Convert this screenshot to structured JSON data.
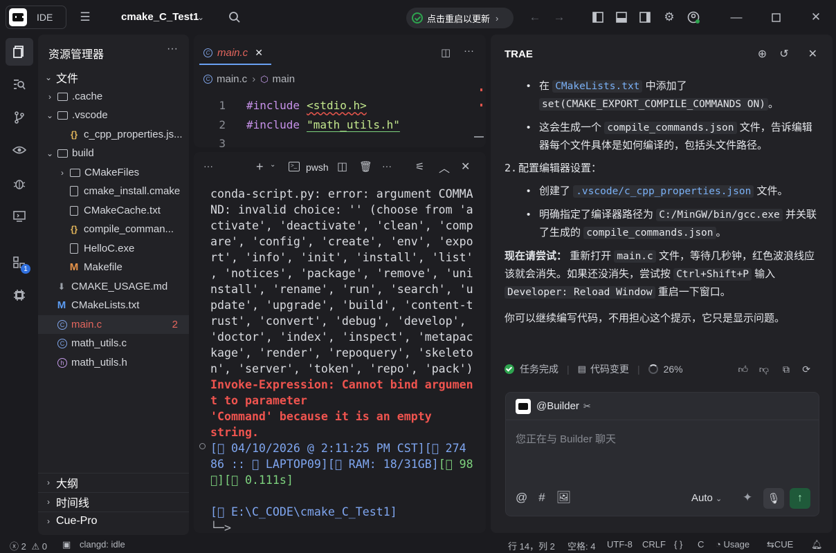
{
  "titlebar": {
    "logo_label": "IDE",
    "project_name": "cmake_C_Test1",
    "update_label": "点击重启以更新"
  },
  "activity": {
    "extensions_badge": "1"
  },
  "explorer": {
    "title": "资源管理器",
    "root_label": "文件",
    "items": [
      {
        "label": ".cache"
      },
      {
        "label": ".vscode"
      },
      {
        "label": "c_cpp_properties.js..."
      },
      {
        "label": "build"
      },
      {
        "label": "CMakeFiles"
      },
      {
        "label": "cmake_install.cmake"
      },
      {
        "label": "CMakeCache.txt"
      },
      {
        "label": "compile_comman..."
      },
      {
        "label": "HelloC.exe"
      },
      {
        "label": "Makefile"
      },
      {
        "label": "CMAKE_USAGE.md"
      },
      {
        "label": "CMakeLists.txt"
      },
      {
        "label": "main.c",
        "errors": "2"
      },
      {
        "label": "math_utils.c"
      },
      {
        "label": "math_utils.h"
      }
    ],
    "sections": [
      "大纲",
      "时间线",
      "Cue-Pro"
    ]
  },
  "editor": {
    "tab_label": "main.c",
    "breadcrumb_file": "main.c",
    "breadcrumb_symbol": "main",
    "lines": [
      {
        "num": "1",
        "kw": "#include",
        "arg": "<stdio.h>"
      },
      {
        "num": "2",
        "kw": "#include",
        "arg": "\"math_utils.h\""
      },
      {
        "num": "3",
        "kw": "",
        "arg": ""
      }
    ]
  },
  "terminal": {
    "shell_label": "pwsh",
    "error_text": "conda-script.py: error: argument COMMA\nND: invalid choice: '' (choose from 'a\nctivate', 'deactivate', 'clean', 'comp\nare', 'config', 'create', 'env', 'expo\nrt', 'info', 'init', 'install', 'list'\n, 'notices', 'package', 'remove', 'uni\nnstall', 'rename', 'run', 'search', 'u\npdate', 'upgrade', 'build', 'content-t\nrust', 'convert', 'debug', 'develop',\n'doctor', 'index', 'inspect', 'metapac\nkage', 'render', 'repoquery', 'skeleto\nn', 'server', 'token', 'repo', 'pack')",
    "invoke_error": "Invoke-Expression: Cannot bind argumen\nt to parameter\n'Command' because it is an empty\nstring.",
    "prompt_date": "[\u0000 04/10/2026 @ 2:11:25 PM CST][\u0000 274",
    "prompt_line2a": "86 :: \u0000 LAPTOP09][\u0000 RAM: 18/31GB]",
    "prompt_line2b": "[\u0000 98",
    "prompt_line3": "\u0000][\u0000 0.111s]",
    "prompt_path": "[\u0000 E:\\C_CODE\\cmake_C_Test1]",
    "prompt_arrow": "└─>"
  },
  "chat": {
    "title": "TRAE",
    "b1_pre": "在",
    "b1_code": "CMakeLists.txt",
    "b1_mid": "中添加了",
    "b1_code2": "set(CMAKE_EXPORT_COMPILE_COMMANDS ON)",
    "b1_end": "。",
    "b2_pre": "这会生成一个",
    "b2_code": "compile_commands.json",
    "b2_post": "文件，告诉编辑器每个文件具体是如何编译的，包括头文件路径。",
    "step2_num": "2.",
    "step2_title": "配置编辑器设置：",
    "b3_pre": "创建了",
    "b3_code": ".vscode/c_cpp_properties.json",
    "b3_post": "文件。",
    "b4_pre": "明确指定了编译器路径为",
    "b4_code": "C:/MinGW/bin/gcc.exe",
    "b4_mid": "并关联了生成的",
    "b4_code2": "compile_commands.json",
    "b4_end": "。",
    "try_bold": "现在请尝试：",
    "try_pre": "重新打开",
    "try_code": "main.c",
    "try_mid": "文件，等待几秒钟，红色波浪线应该就会消失。如果还没消失，尝试按",
    "try_code2": "Ctrl+Shift+P",
    "try_mid2": "输入",
    "try_code3": "Developer: Reload Window",
    "try_end": "重启一下窗口。",
    "closing": "你可以继续编写代码，不用担心这个提示，它只是显示问题。",
    "task_done": "任务完成",
    "code_changes": "代码变更",
    "progress": "26%",
    "builder_label": "@Builder",
    "input_placeholder": "您正在与 Builder 聊天",
    "model_select": "Auto"
  },
  "statusbar": {
    "errors": "2",
    "warnings": "0",
    "clangd": "clangd: idle",
    "position": "行 14，列 2",
    "spaces": "空格: 4",
    "encoding": "UTF-8",
    "eol": "CRLF",
    "braces": "{ }",
    "language": "C",
    "usage": "Usage",
    "cue": "CUE"
  }
}
